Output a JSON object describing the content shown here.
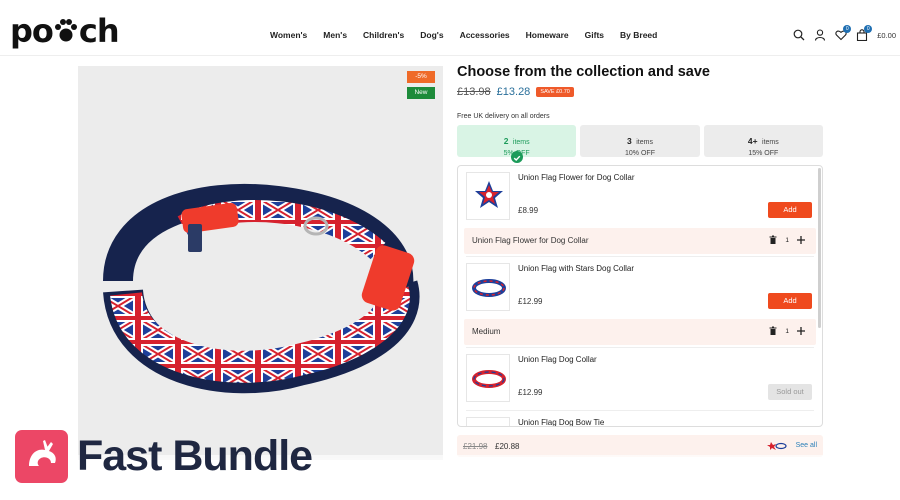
{
  "header": {
    "logo_text": "po  ch",
    "nav": [
      "Women's",
      "Men's",
      "Children's",
      "Dog's",
      "Accessories",
      "Homeware",
      "Gifts",
      "By Breed"
    ],
    "icons": [
      "search-icon",
      "user-icon",
      "heart-icon",
      "cart-icon"
    ],
    "wishlist_count": "0",
    "cart_count": "0",
    "cart_total": "£0.00"
  },
  "product": {
    "discount_badge": "-5%",
    "new_badge": "New",
    "image_alt": "Union flag dog collar",
    "brand_colors": {
      "accent": "#ef4a1e",
      "green": "#1c9b5a",
      "price_blue": "#2a6f9a"
    }
  },
  "bundle": {
    "title": "Choose from the collection and save",
    "old_price": "£13.98",
    "new_price": "£13.28",
    "save_badge": "SAVE £0.70",
    "delivery": "Free UK delivery on all orders",
    "tiers": [
      {
        "qty": "2",
        "unit": "items",
        "off": "5% OFF",
        "active": true
      },
      {
        "qty": "3",
        "unit": "items",
        "off": "10% OFF",
        "active": false
      },
      {
        "qty": "4+",
        "unit": "items",
        "off": "15% OFF",
        "active": false
      }
    ],
    "items": [
      {
        "name": "Union Flag Flower for Dog Collar",
        "price": "£8.99",
        "button": "Add",
        "variant": "Union Flag Flower for Dog Collar",
        "qty": "1"
      },
      {
        "name": "Union Flag with Stars Dog Collar",
        "price": "£12.99",
        "button": "Add",
        "variant": "Medium",
        "qty": "1"
      },
      {
        "name": "Union Flag Dog Collar",
        "price": "£12.99",
        "button": "Sold out"
      },
      {
        "name": "Union Flag Dog Bow Tie"
      }
    ],
    "footer": {
      "old_total": "£21.98",
      "new_total": "£20.88",
      "see_all": "See all"
    }
  },
  "banner": {
    "text": "Fast Bundle"
  }
}
